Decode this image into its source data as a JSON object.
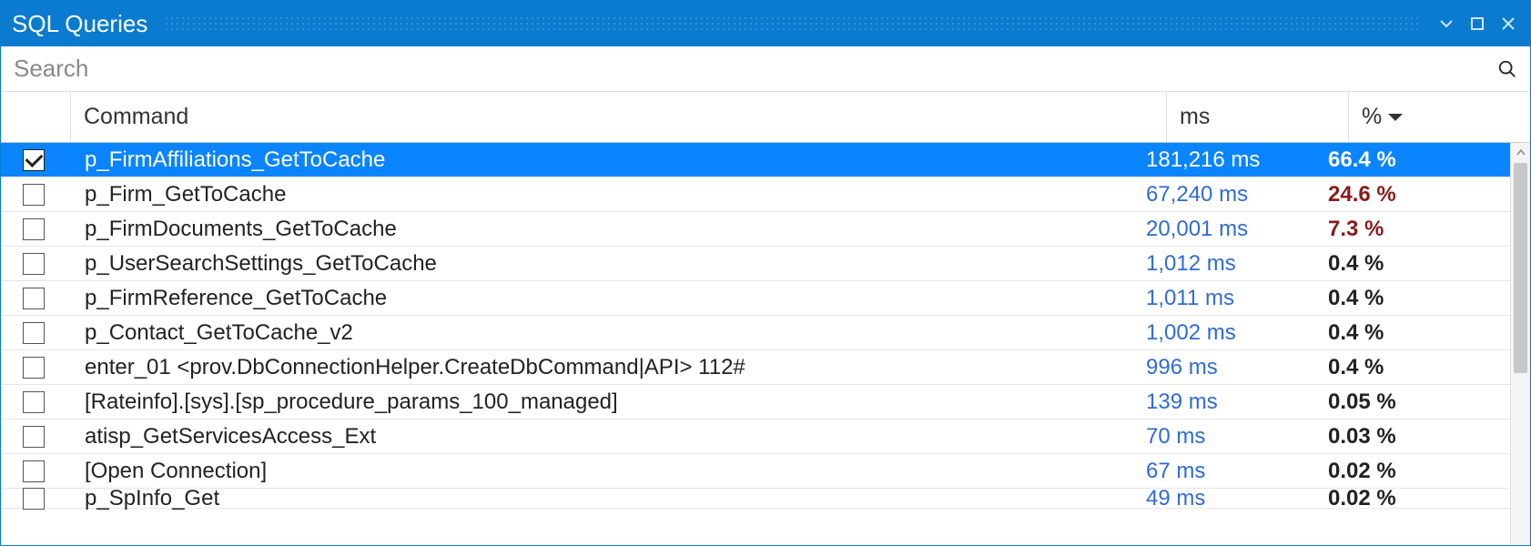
{
  "titlebar": {
    "title": "SQL Queries"
  },
  "search": {
    "placeholder": "Search"
  },
  "columns": {
    "command": "Command",
    "ms": "ms",
    "pct": "%"
  },
  "rows": [
    {
      "checked": true,
      "selected": true,
      "hot": false,
      "command": "p_FirmAffiliations_GetToCache",
      "ms": "181,216 ms",
      "pct": "66.4 %"
    },
    {
      "checked": false,
      "selected": false,
      "hot": true,
      "command": "p_Firm_GetToCache",
      "ms": "67,240 ms",
      "pct": "24.6 %"
    },
    {
      "checked": false,
      "selected": false,
      "hot": true,
      "command": "p_FirmDocuments_GetToCache",
      "ms": "20,001 ms",
      "pct": "7.3 %"
    },
    {
      "checked": false,
      "selected": false,
      "hot": false,
      "command": "p_UserSearchSettings_GetToCache",
      "ms": "1,012 ms",
      "pct": "0.4 %"
    },
    {
      "checked": false,
      "selected": false,
      "hot": false,
      "command": "p_FirmReference_GetToCache",
      "ms": "1,011 ms",
      "pct": "0.4 %"
    },
    {
      "checked": false,
      "selected": false,
      "hot": false,
      "command": "p_Contact_GetToCache_v2",
      "ms": "1,002 ms",
      "pct": "0.4 %"
    },
    {
      "checked": false,
      "selected": false,
      "hot": false,
      "command": "enter_01 <prov.DbConnectionHelper.CreateDbCommand|API> 112#",
      "ms": "996 ms",
      "pct": "0.4 %"
    },
    {
      "checked": false,
      "selected": false,
      "hot": false,
      "command": "[Rateinfo].[sys].[sp_procedure_params_100_managed]",
      "ms": "139 ms",
      "pct": "0.05 %"
    },
    {
      "checked": false,
      "selected": false,
      "hot": false,
      "command": "atisp_GetServicesAccess_Ext",
      "ms": "70 ms",
      "pct": "0.03 %"
    },
    {
      "checked": false,
      "selected": false,
      "hot": false,
      "command": "[Open Connection]",
      "ms": "67 ms",
      "pct": "0.02 %"
    },
    {
      "checked": false,
      "selected": false,
      "hot": false,
      "partial": true,
      "command": "p_SpInfo_Get",
      "ms": "49 ms",
      "pct": "0.02 %"
    }
  ]
}
